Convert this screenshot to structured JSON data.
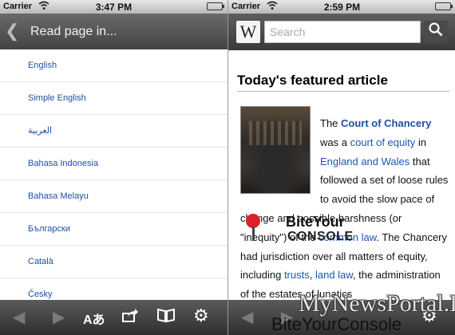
{
  "left_screen": {
    "status": {
      "carrier": "Carrier",
      "time": "3:47 PM"
    },
    "nav": {
      "title": "Read page in..."
    },
    "languages": [
      "English",
      "Simple English",
      "العربية",
      "Bahasa Indonesia",
      "Bahasa Melayu",
      "Български",
      "Català",
      "Česky"
    ],
    "toolbar": {
      "font_label": "Aあ"
    }
  },
  "right_screen": {
    "status": {
      "carrier": "Carrier",
      "time": "2:59 PM"
    },
    "search": {
      "logo": "W",
      "placeholder": "Search"
    },
    "article": {
      "heading": "Today's featured article",
      "parts": {
        "p1": "The ",
        "title_link": "Court of Chancery",
        "p2": " was a ",
        "link_equity": "court of equity",
        "p3": " in ",
        "link_england": "England and Wales",
        "p4": " that followed a set of loose rules to avoid the slow pace of change and possible harshness (or \"inequity\") of the ",
        "link_common": "common law",
        "p5": ". The Chancery had jurisdiction over all matters of equity, including ",
        "link_trusts": "trusts",
        "p6": ", ",
        "link_land": "land law",
        "p7": ", the administration of the estates of lunatics"
      }
    }
  },
  "watermarks": {
    "bite_line1": "BiteYour",
    "bite_line2": "CONSOLE",
    "news": "MyNewsPortal.IT",
    "bite_bottom": "BiteYourConsole"
  },
  "colors": {
    "link": "#1f57b5",
    "list_text": "#1f4fa0",
    "nav_dark": "#434343"
  }
}
